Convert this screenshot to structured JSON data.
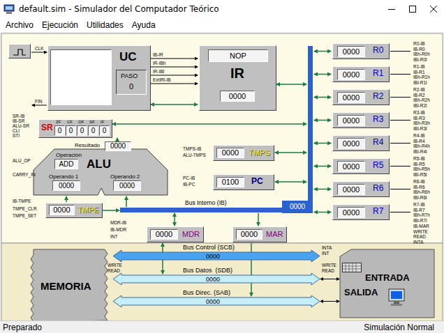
{
  "window": {
    "title": "default.sim - Simulador del Computador Teórico"
  },
  "menu": [
    "Archivo",
    "Ejecución",
    "Utilidades",
    "Ayuda"
  ],
  "uc": {
    "name": "UC",
    "step_label": "PASO",
    "step": "0",
    "clock_label": "CLK",
    "end_label": "FIN",
    "signals": [
      "IB-IR",
      "IR-IBh",
      "IR-IBl",
      "ExtIRl-IB"
    ]
  },
  "ir": {
    "name": "IR",
    "instruction": "NOP",
    "value": "0000"
  },
  "registers": [
    {
      "name": "R0",
      "value": "0000",
      "signals": [
        "R0-IB",
        "IB-R0",
        "IBh-R0h",
        "IBl-R0l"
      ]
    },
    {
      "name": "R1",
      "value": "0000",
      "signals": [
        "R1-IB",
        "IB-R1",
        "IBh-R1h",
        "IBl-R1l"
      ]
    },
    {
      "name": "R2",
      "value": "0000",
      "signals": [
        "R2-IB",
        "IB-R2",
        "IBh-R2h",
        "IBl-R2l"
      ]
    },
    {
      "name": "R3",
      "value": "0000",
      "signals": [
        "R3-IB",
        "IB-R3",
        "IBh-R3h",
        "IBl-R3l"
      ]
    },
    {
      "name": "R4",
      "value": "0000",
      "signals": [
        "R4-IB",
        "IB-R4",
        "IBh-R4h",
        "IBl-R4l"
      ]
    },
    {
      "name": "R5",
      "value": "0000",
      "signals": [
        "R5-IB",
        "IB-R5",
        "IBh-R5h",
        "IBl-R5l"
      ]
    },
    {
      "name": "R6",
      "value": "0000",
      "signals": [
        "R6-IB",
        "IB-R6",
        "IBh-R6h",
        "IBl-R6l"
      ]
    },
    {
      "name": "R7",
      "value": "0000",
      "signals": [
        "R7-IB",
        "IB-R7",
        "IBh-R7h",
        "IBl-R7l"
      ]
    }
  ],
  "sr": {
    "name": "SR",
    "signals": [
      "SR-IB",
      "IB-SR",
      "ALU-SR",
      "CLI",
      "STI"
    ],
    "flags": [
      {
        "name": "ZF",
        "value": "0"
      },
      {
        "name": "CF",
        "value": "0"
      },
      {
        "name": "OF",
        "value": "0"
      },
      {
        "name": "SF",
        "value": "0"
      },
      {
        "name": "IF",
        "value": "0"
      }
    ]
  },
  "alu": {
    "name": "ALU",
    "result_label": "Resultado",
    "result": "0000",
    "operation_label": "Operación",
    "operation": "ADD",
    "operand1_label": "Operando 1",
    "operand1": "0000",
    "operand2_label": "Operando 2",
    "operand2": "0000",
    "signals": [
      "ALU_OP",
      "CARRY_IN"
    ]
  },
  "tmps": {
    "name": "TMPS",
    "value": "0000",
    "signals": [
      "TMPS-IB",
      "ALU-TMPS"
    ]
  },
  "pc": {
    "name": "PC",
    "value": "0100",
    "signals": [
      "PC-IB",
      "IB-PC"
    ]
  },
  "tmpe": {
    "name": "TMPE",
    "value": "0000",
    "signals": [
      "IB-TMPE",
      "TMPE_CLR",
      "TMPE_SET"
    ]
  },
  "internal_bus": {
    "label": "Bus Interno (IB)",
    "value": "0000"
  },
  "mdr": {
    "name": "MDR",
    "value": "0000",
    "signals": [
      "MDR-IB",
      "IB-MDR",
      "INT"
    ]
  },
  "mar": {
    "name": "MAR",
    "value": "0000",
    "signals": [
      "IB-MAR",
      "WRITE",
      "READ",
      "INTA"
    ]
  },
  "system_buses": [
    {
      "label": "Bus Control (SCB)",
      "value": "0000"
    },
    {
      "label": "Bus Datos  (SDB)",
      "value": "0000"
    },
    {
      "label": "Bus Direc. (SAB)",
      "value": "0000"
    }
  ],
  "memory": {
    "name": "MEMORIA",
    "signals": [
      "WRITE",
      "READ"
    ]
  },
  "io": {
    "name_in": "ENTRADA",
    "name_out": "SALIDA",
    "signals": [
      "INTA",
      "INT",
      "WRITE",
      "READ"
    ]
  },
  "status_bar": {
    "left": "Preparado",
    "right": "Simulación Normal"
  }
}
